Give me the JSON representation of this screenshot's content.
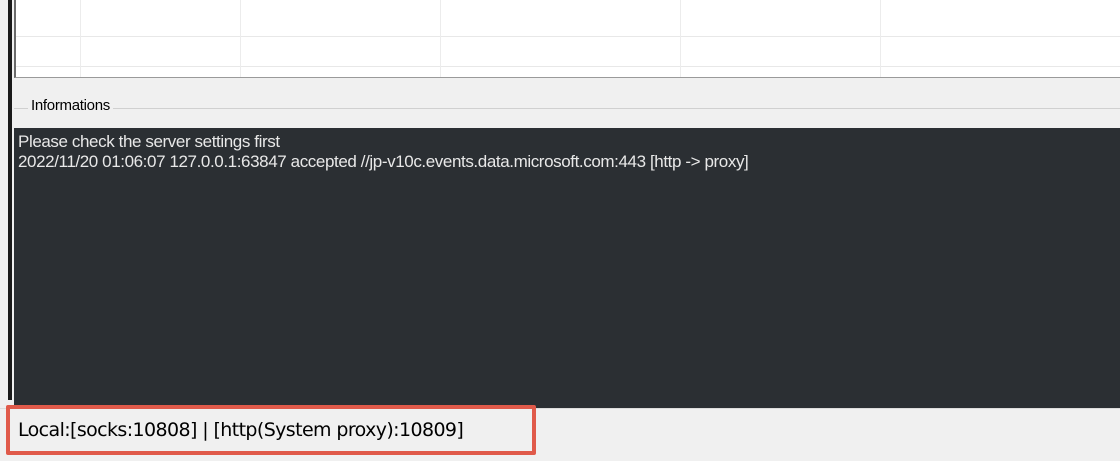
{
  "informations": {
    "title": "Informations",
    "log_lines": [
      "Please check the server settings first",
      "2022/11/20 01:06:07 127.0.0.1:63847 accepted //jp-v10c.events.data.microsoft.com:443 [http -> proxy]"
    ]
  },
  "statusbar": {
    "text": "Local:[socks:10808] | [http(System proxy):10809]"
  },
  "colors": {
    "console_background": "#2b2f33",
    "console_text": "#e8e8e8",
    "highlight": "#e05a4a"
  }
}
